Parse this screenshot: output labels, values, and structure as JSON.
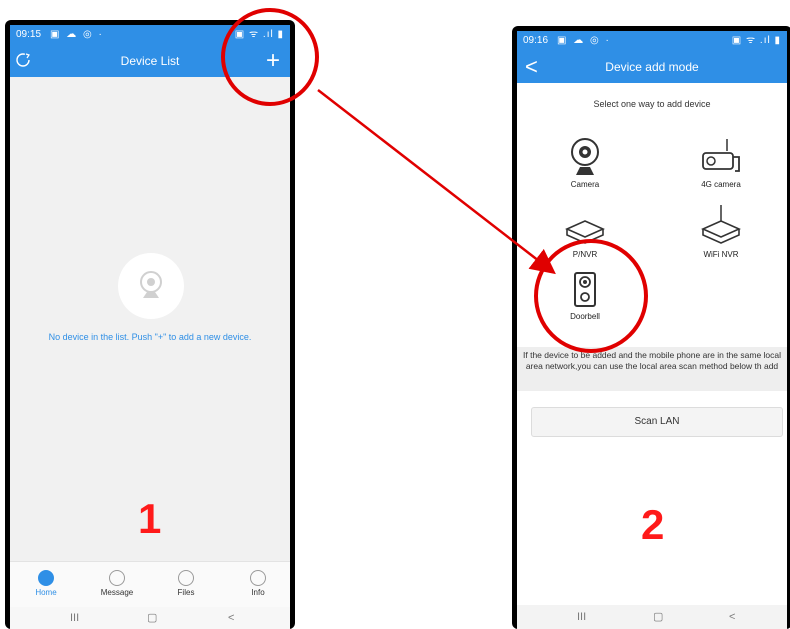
{
  "screen1": {
    "status": {
      "time": "09:15",
      "left_icons": "▣ ☁ ◎ ·",
      "right_icons": "▣ ᯤ .ıl ▮"
    },
    "header": {
      "title": "Device List",
      "add_label": "+"
    },
    "empty_message": "No device in the list. Push \"+\" to add a new device.",
    "annotation_number": "1",
    "bottom_nav": [
      {
        "label": "Home",
        "icon": "camera-icon"
      },
      {
        "label": "Message",
        "icon": "message-icon"
      },
      {
        "label": "Files",
        "icon": "image-icon"
      },
      {
        "label": "Info",
        "icon": "user-icon"
      }
    ],
    "system_nav": {
      "recents": "III",
      "home": "▢",
      "back": "<"
    }
  },
  "screen2": {
    "status": {
      "time": "09:16",
      "left_icons": "▣ ☁ ◎ ·",
      "right_icons": "▣ ᯤ .ıl ▮"
    },
    "header": {
      "title": "Device add mode",
      "back_label": "<"
    },
    "select_text": "Select one way to add device",
    "options": [
      {
        "label": "Camera",
        "icon": "webcam-icon"
      },
      {
        "label": "4G camera",
        "icon": "bullet-camera-icon"
      },
      {
        "label": "WiFi NVR",
        "icon": "router-icon"
      },
      {
        "label": "Doorbell",
        "icon": "doorbell-icon"
      }
    ],
    "hidden_option_label": "P/NVR",
    "info_text": "If the device to be added and the mobile phone are in the same local area network,you can use the local area scan method below th add",
    "scan_button": "Scan LAN",
    "annotation_number": "2",
    "system_nav": {
      "recents": "III",
      "home": "▢",
      "back": "<"
    }
  },
  "colors": {
    "accent": "#2f8fe6",
    "annotation": "#ff1a1a"
  }
}
